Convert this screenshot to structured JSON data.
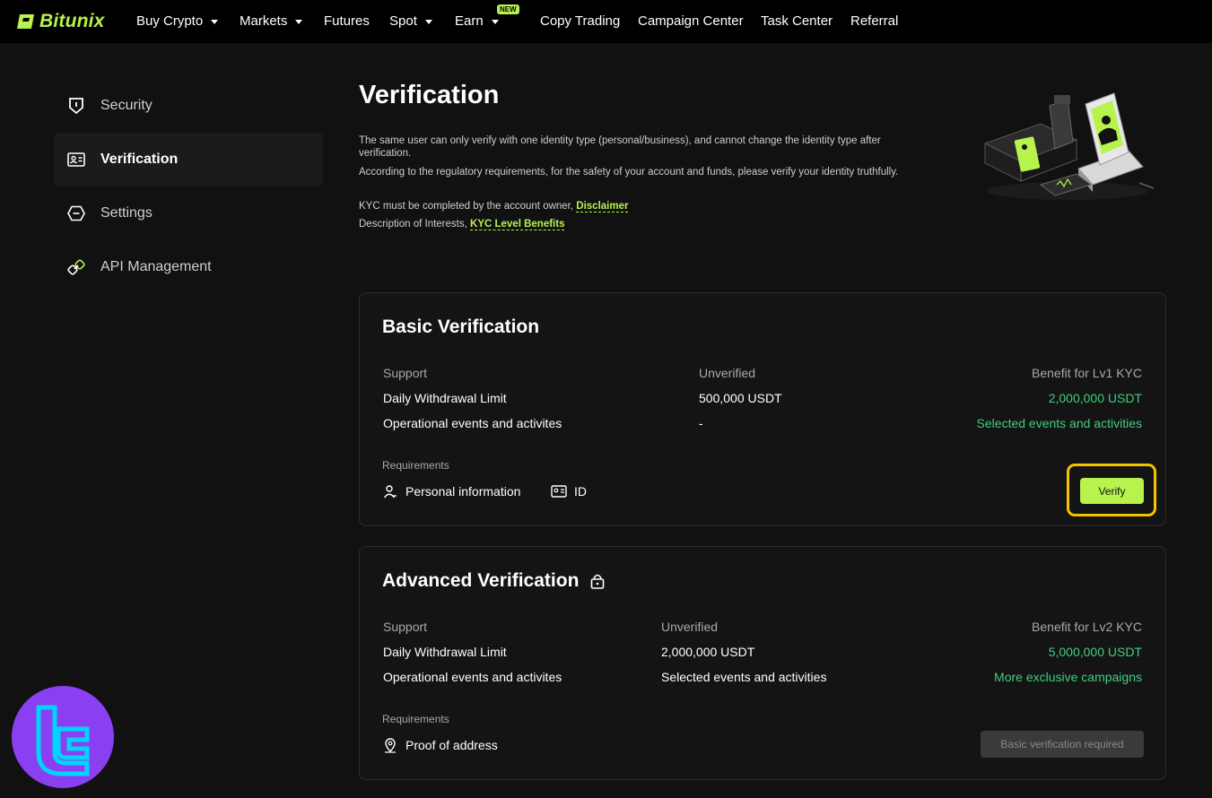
{
  "brand": {
    "name": "Bitunix",
    "accent": "#b8f24d",
    "positive": "#3fcf7f"
  },
  "nav": {
    "items": [
      {
        "label": "Buy Crypto",
        "dropdown": true
      },
      {
        "label": "Markets",
        "dropdown": true
      },
      {
        "label": "Futures",
        "dropdown": false
      },
      {
        "label": "Spot",
        "dropdown": true
      },
      {
        "label": "Earn",
        "dropdown": true,
        "badge": "NEW"
      },
      {
        "label": "Copy Trading",
        "dropdown": false
      },
      {
        "label": "Campaign Center",
        "dropdown": false
      },
      {
        "label": "Task Center",
        "dropdown": false
      },
      {
        "label": "Referral",
        "dropdown": false
      }
    ]
  },
  "sidebar": {
    "items": [
      {
        "label": "Security",
        "icon": "shield-icon",
        "active": false
      },
      {
        "label": "Verification",
        "icon": "id-card-icon",
        "active": true
      },
      {
        "label": "Settings",
        "icon": "hexagon-icon",
        "active": false
      },
      {
        "label": "API Management",
        "icon": "link-icon",
        "active": false
      }
    ]
  },
  "main": {
    "title": "Verification",
    "desc_line1": "The same user can only verify with one identity type (personal/business), and cannot change the identity type after",
    "desc_line1b": "verification.",
    "desc_line2": "According to the regulatory requirements, for the safety of your account and funds, please verify your identity truthfully.",
    "kyc_owner_text": "KYC must be completed by the account owner,",
    "disclaimer_link": "Disclaimer",
    "interests_text": "Description of Interests,",
    "benefits_link": "KYC Level Benefits"
  },
  "basic": {
    "title": "Basic Verification",
    "col1": "Support",
    "col2": "Unverified",
    "col3": "Benefit for Lv1 KYC",
    "row1": {
      "label": "Daily Withdrawal Limit",
      "current": "500,000  USDT",
      "benefit": "2,000,000  USDT"
    },
    "row2": {
      "label": "Operational events and activites",
      "current": "-",
      "benefit": "Selected events and activities"
    },
    "requirements_label": "Requirements",
    "req1": "Personal information",
    "req2": "ID",
    "button": "Verify"
  },
  "advanced": {
    "title": "Advanced Verification",
    "col1": "Support",
    "col2": "Unverified",
    "col3": "Benefit for Lv2 KYC",
    "row1": {
      "label": "Daily Withdrawal Limit",
      "current": "2,000,000  USDT",
      "benefit": "5,000,000  USDT"
    },
    "row2": {
      "label": "Operational events and activites",
      "current": "Selected events and activities",
      "benefit": "More exclusive campaigns"
    },
    "requirements_label": "Requirements",
    "req1": "Proof of address",
    "button": "Basic verification required"
  }
}
